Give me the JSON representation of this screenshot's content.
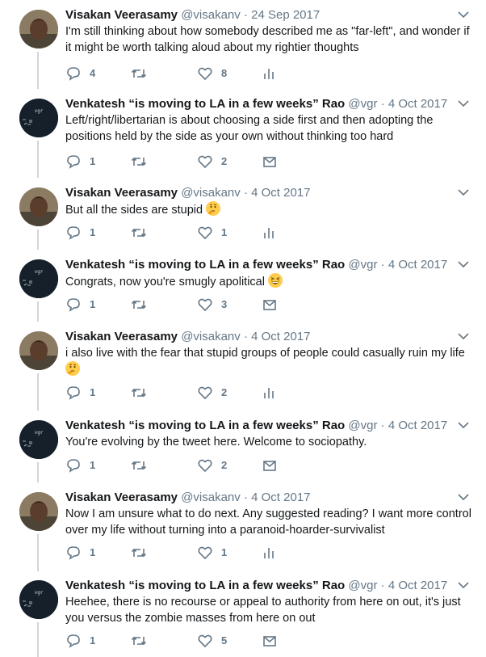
{
  "tweets": [
    {
      "author": "visakan",
      "name": "Visakan Veerasamy",
      "handle": "@visakanv",
      "date": "24 Sep 2017",
      "text": "I'm still thinking about how somebody described me as \"far-left\", and wonder if it might be worth talking aloud about my rightier thoughts",
      "emoji": "",
      "replies": "4",
      "retweets": "",
      "likes": "8",
      "last_action": "analytics-icon"
    },
    {
      "author": "vgr",
      "name": "Venkatesh “is moving to LA in a few weeks” Rao",
      "handle": "@vgr",
      "date": "4 Oct 2017",
      "text": "Left/right/libertarian is about choosing a side first and then adopting the positions held by the side as your own without thinking too hard",
      "emoji": "",
      "replies": "1",
      "retweets": "",
      "likes": "2",
      "last_action": "message-icon"
    },
    {
      "author": "visakan",
      "name": "Visakan Veerasamy",
      "handle": "@visakanv",
      "date": "4 Oct 2017",
      "text": "But all the sides are stupid",
      "emoji": "thinking-face",
      "replies": "1",
      "retweets": "",
      "likes": "1",
      "last_action": "analytics-icon"
    },
    {
      "author": "vgr",
      "name": "Venkatesh “is moving to LA in a few weeks” Rao",
      "handle": "@vgr",
      "date": "4 Oct 2017",
      "text": "Congrats, now you're smugly apolitical",
      "emoji": "grinning-squinting-face",
      "replies": "1",
      "retweets": "",
      "likes": "3",
      "last_action": "message-icon"
    },
    {
      "author": "visakan",
      "name": "Visakan Veerasamy",
      "handle": "@visakanv",
      "date": "4 Oct 2017",
      "text": "i also live with the fear that stupid groups of people could casually ruin my life",
      "emoji": "thinking-face",
      "replies": "1",
      "retweets": "",
      "likes": "2",
      "last_action": "analytics-icon"
    },
    {
      "author": "vgr",
      "name": "Venkatesh “is moving to LA in a few weeks” Rao",
      "handle": "@vgr",
      "date": "4 Oct 2017",
      "text": "You're evolving by the tweet here. Welcome to sociopathy.",
      "emoji": "",
      "replies": "1",
      "retweets": "",
      "likes": "2",
      "last_action": "message-icon"
    },
    {
      "author": "visakan",
      "name": "Visakan Veerasamy",
      "handle": "@visakanv",
      "date": "4 Oct 2017",
      "text": "Now I am unsure what to do next. Any suggested reading? I want more control over my life without turning into a paranoid-hoarder-survivalist",
      "emoji": "",
      "replies": "1",
      "retweets": "",
      "likes": "1",
      "last_action": "analytics-icon"
    },
    {
      "author": "vgr",
      "name": "Venkatesh “is moving to LA in a few weeks” Rao",
      "handle": "@vgr",
      "date": "4 Oct 2017",
      "text": "Heehee, there is no recourse or appeal to authority from here on out, it's just you versus the zombie masses from here on out",
      "emoji": "",
      "replies": "1",
      "retweets": "",
      "likes": "5",
      "last_action": "message-icon"
    }
  ],
  "avatar_labels": {
    "vgr": "vgr"
  },
  "colors": {
    "name": "#14171a",
    "secondary": "#657786",
    "thread_line": "#ccd6dd",
    "emoji_yellow": "#ffcc4d"
  }
}
